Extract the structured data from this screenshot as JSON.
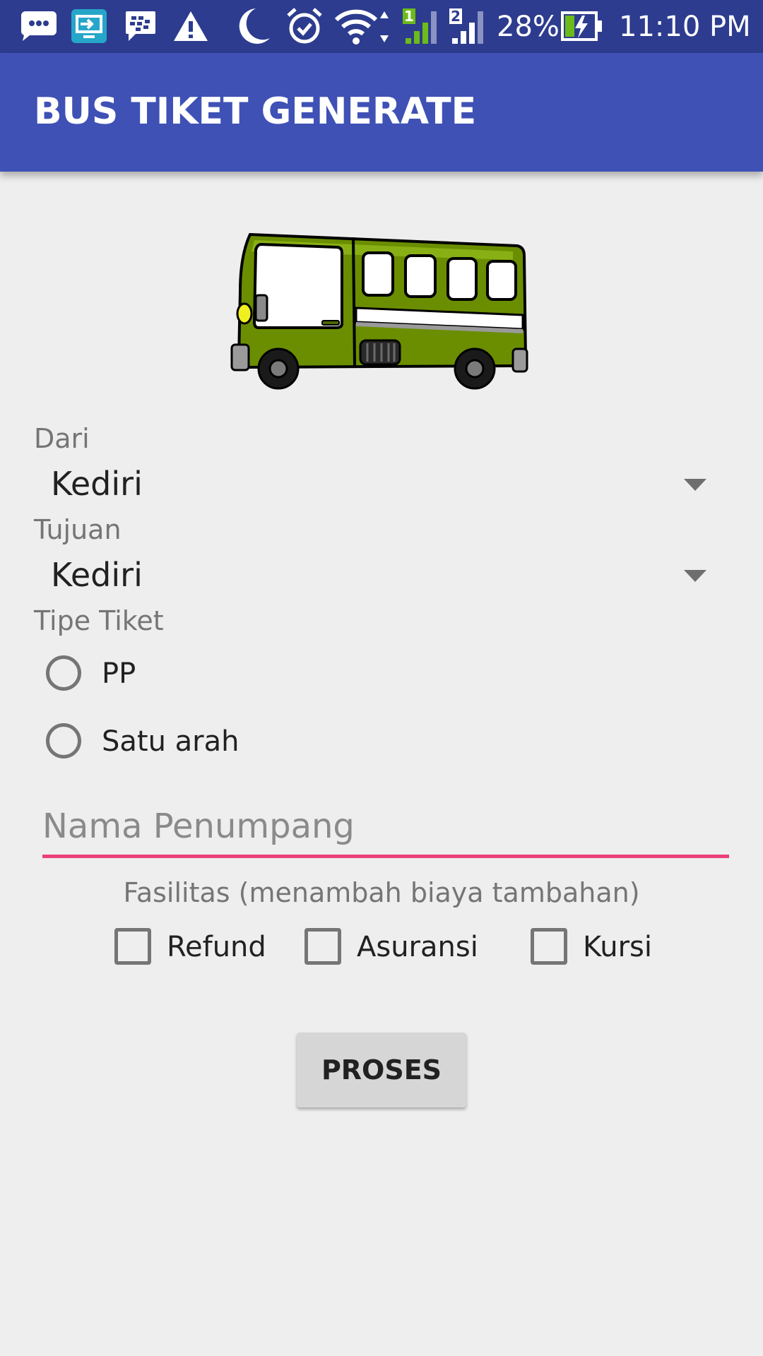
{
  "status_bar": {
    "battery_percent": "28%",
    "time": "11:10 PM",
    "sim1_label": "1",
    "sim2_label": "2",
    "icons": [
      "chat-bubble-icon",
      "screen-cast-icon",
      "bbm-icon",
      "warning-icon",
      "moon-icon",
      "alarm-icon",
      "wifi-icon",
      "signal-sim1-icon",
      "signal-sim2-icon",
      "battery-charging-icon"
    ]
  },
  "app_bar": {
    "title": "BUS TIKET GENERATE",
    "color": "#3f51b5"
  },
  "hero": {
    "icon": "bus-illustration",
    "body_color": "#6b8e00"
  },
  "form": {
    "dari_label": "Dari",
    "dari_value": "Kediri",
    "tujuan_label": "Tujuan",
    "tujuan_value": "Kediri",
    "tipe_tiket_label": "Tipe Tiket",
    "tipe_options": [
      "PP",
      "Satu arah"
    ],
    "tipe_selected": null,
    "nama_placeholder": "Nama Penumpang",
    "nama_value": "",
    "accent_color": "#ec407a",
    "fasilitas_label": "Fasilitas (menambah biaya tambahan)",
    "fasilitas_options": [
      "Refund",
      "Asuransi",
      "Kursi"
    ],
    "fasilitas_checked": [
      false,
      false,
      false
    ],
    "submit_label": "PROSES"
  }
}
